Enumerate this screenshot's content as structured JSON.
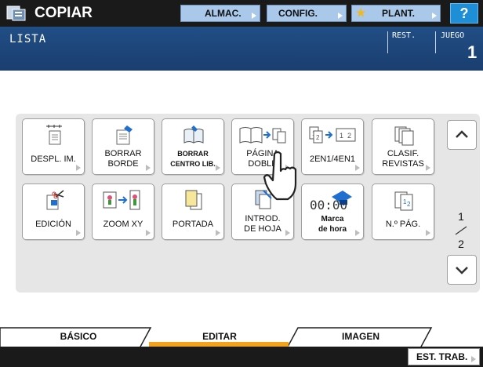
{
  "header": {
    "title": "COPIAR",
    "buttons": {
      "almac": "ALMAC.",
      "config": "CONFIG.",
      "plant": "PLANT.",
      "help": "?"
    }
  },
  "status": {
    "mode": "LISTA",
    "rest_label": "REST.",
    "juego_label": "JUEGO",
    "juego_value": "1"
  },
  "functions": {
    "row1": [
      {
        "label": "DESPL. IM.",
        "icon": "image-shift-icon"
      },
      {
        "label": "BORRAR\nBORDE",
        "icon": "edge-erase-icon"
      },
      {
        "label": "BORRAR\nCENTRO LIB.",
        "icon": "book-center-erase-icon"
      },
      {
        "label": "PÁGINA\nDOBLE",
        "icon": "book-to-pages-icon"
      },
      {
        "label": "2EN1/4EN1",
        "icon": "two-in-one-icon"
      },
      {
        "label": "CLASIF.\nREVISTAS",
        "icon": "magazine-sort-icon"
      }
    ],
    "row2": [
      {
        "label": "EDICIÓN",
        "icon": "edit-scissors-icon"
      },
      {
        "label": "ZOOM XY",
        "icon": "xy-zoom-icon"
      },
      {
        "label": "PORTADA",
        "icon": "cover-sheet-icon"
      },
      {
        "label": "INTROD.\nDE HOJA",
        "icon": "sheet-insert-icon"
      },
      {
        "label": "Marca\nde hora",
        "icon": "time-stamp-icon"
      },
      {
        "label": "N.º PÁG.",
        "icon": "page-number-icon"
      }
    ]
  },
  "pager": {
    "current": "1",
    "total": "2"
  },
  "tabs": {
    "basico": "BÁSICO",
    "editar": "EDITAR",
    "imagen": "IMAGEN",
    "active": "EDITAR"
  },
  "footer": {
    "est_trab": "EST. TRAB."
  },
  "colors": {
    "accent": "#f3a21b",
    "status_bar": "#214e86",
    "topbar": "#1a1a1a",
    "top_button": "#a9c8ea"
  }
}
